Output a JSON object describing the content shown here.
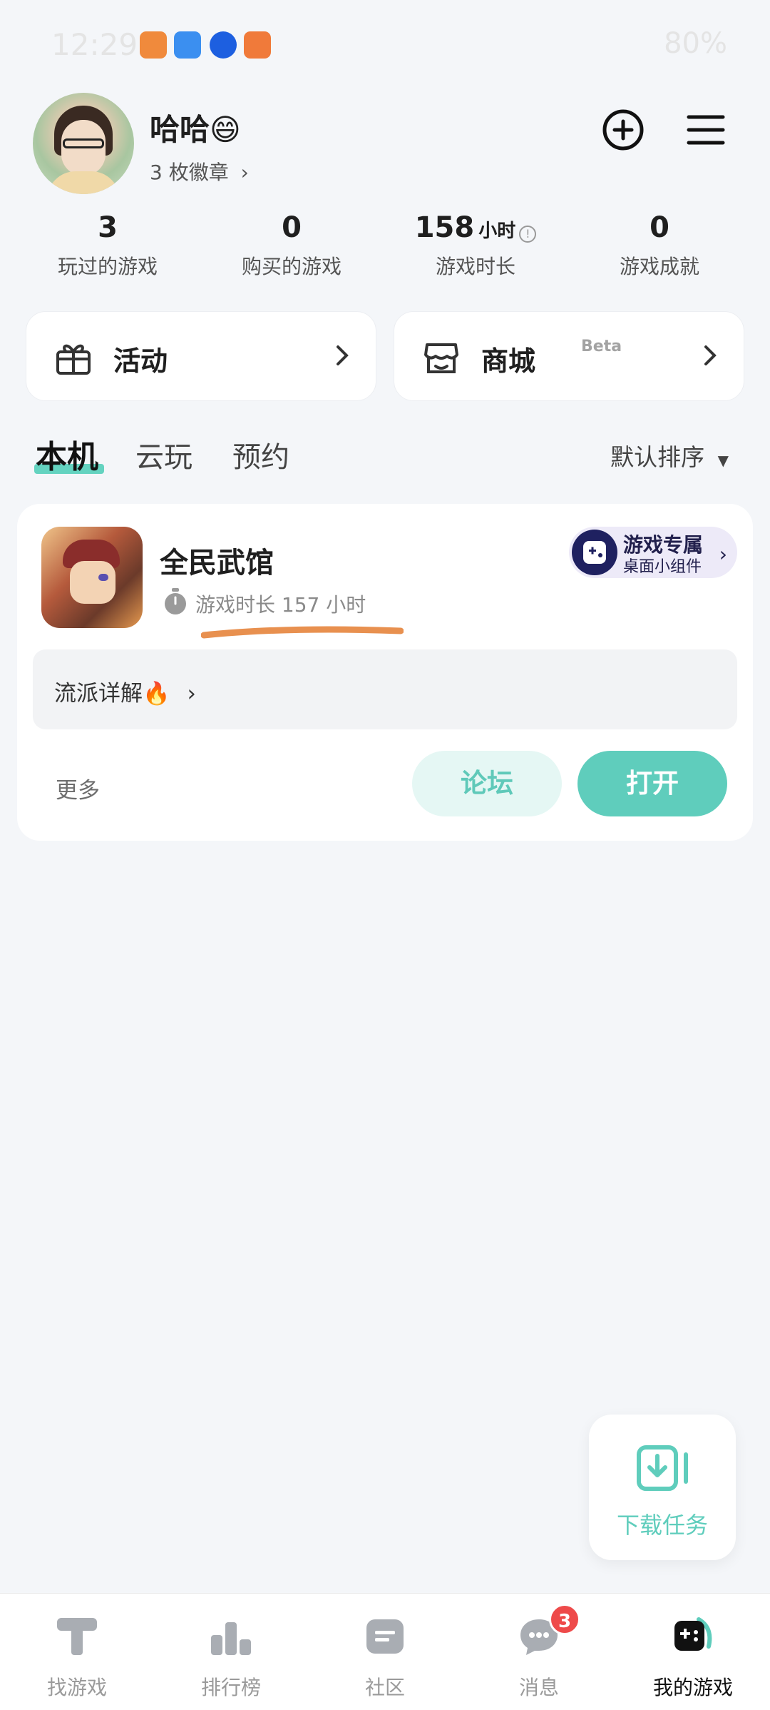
{
  "status_bar": {
    "time": "12:29",
    "battery": "80%"
  },
  "profile": {
    "name": "哈哈😄",
    "badges": "3 枚徽章"
  },
  "stats": [
    {
      "num": "3",
      "unit": "",
      "label": "玩过的游戏"
    },
    {
      "num": "0",
      "unit": "",
      "label": "购买的游戏"
    },
    {
      "num": "158",
      "unit": "小时",
      "label": "游戏时长"
    },
    {
      "num": "0",
      "unit": "",
      "label": "游戏成就"
    }
  ],
  "cards": {
    "activity": "活动",
    "mall": "商城",
    "mall_tag": "Beta"
  },
  "tabs": [
    "本机",
    "云玩",
    "预约"
  ],
  "sort_label": "默认排序",
  "game": {
    "title": "全民武馆",
    "playtime": "游戏时长 157 小时",
    "widget_title": "游戏专属",
    "widget_sub": "桌面小组件",
    "tip": "流派详解🔥",
    "more": "更多",
    "forum_button": "论坛",
    "open_button": "打开"
  },
  "download": {
    "label": "下载任务"
  },
  "bottom_nav": [
    {
      "label": "找游戏"
    },
    {
      "label": "排行榜"
    },
    {
      "label": "社区"
    },
    {
      "label": "消息",
      "badge": "3"
    },
    {
      "label": "我的游戏"
    }
  ],
  "colors": {
    "accent": "#5fcdbc",
    "badge": "#ee4a4a",
    "background": "#f4f6f9"
  }
}
